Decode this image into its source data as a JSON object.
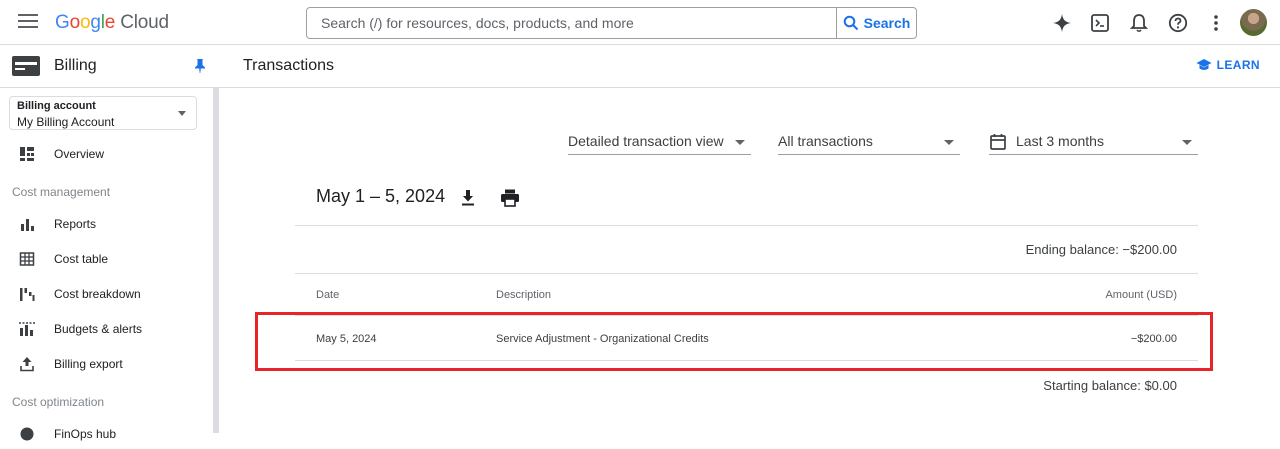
{
  "header": {
    "logo_google": "Google",
    "logo_cloud": "Cloud",
    "search_placeholder": "Search (/) for resources, docs, products, and more",
    "search_button": "Search"
  },
  "sidebar": {
    "title": "Billing",
    "account_label": "Billing account",
    "account_value": "My Billing Account",
    "items": [
      {
        "label": "Overview",
        "icon": "dashboard-icon"
      },
      {
        "label": "Reports",
        "icon": "bar-chart-icon"
      },
      {
        "label": "Cost table",
        "icon": "table-icon"
      },
      {
        "label": "Cost breakdown",
        "icon": "waterfall-icon"
      },
      {
        "label": "Budgets & alerts",
        "icon": "budget-icon"
      },
      {
        "label": "Billing export",
        "icon": "upload-icon"
      },
      {
        "label": "FinOps hub",
        "icon": "hub-icon"
      }
    ],
    "sections": [
      "Cost management",
      "Cost optimization"
    ]
  },
  "main": {
    "title": "Transactions",
    "learn": "LEARN",
    "filters": {
      "view": "Detailed transaction view",
      "type": "All transactions",
      "range": "Last 3 months"
    },
    "date_range": "May 1 – 5, 2024",
    "ending_balance": "Ending balance: −$200.00",
    "starting_balance": "Starting balance: $0.00",
    "columns": [
      "Date",
      "Description",
      "Amount (USD)"
    ],
    "rows": [
      {
        "date": "May 5, 2024",
        "description": "Service Adjustment - Organizational Credits",
        "amount": "−$200.00"
      }
    ]
  },
  "colors": {
    "accent": "#1a73e8",
    "highlight": "#e8232a"
  }
}
